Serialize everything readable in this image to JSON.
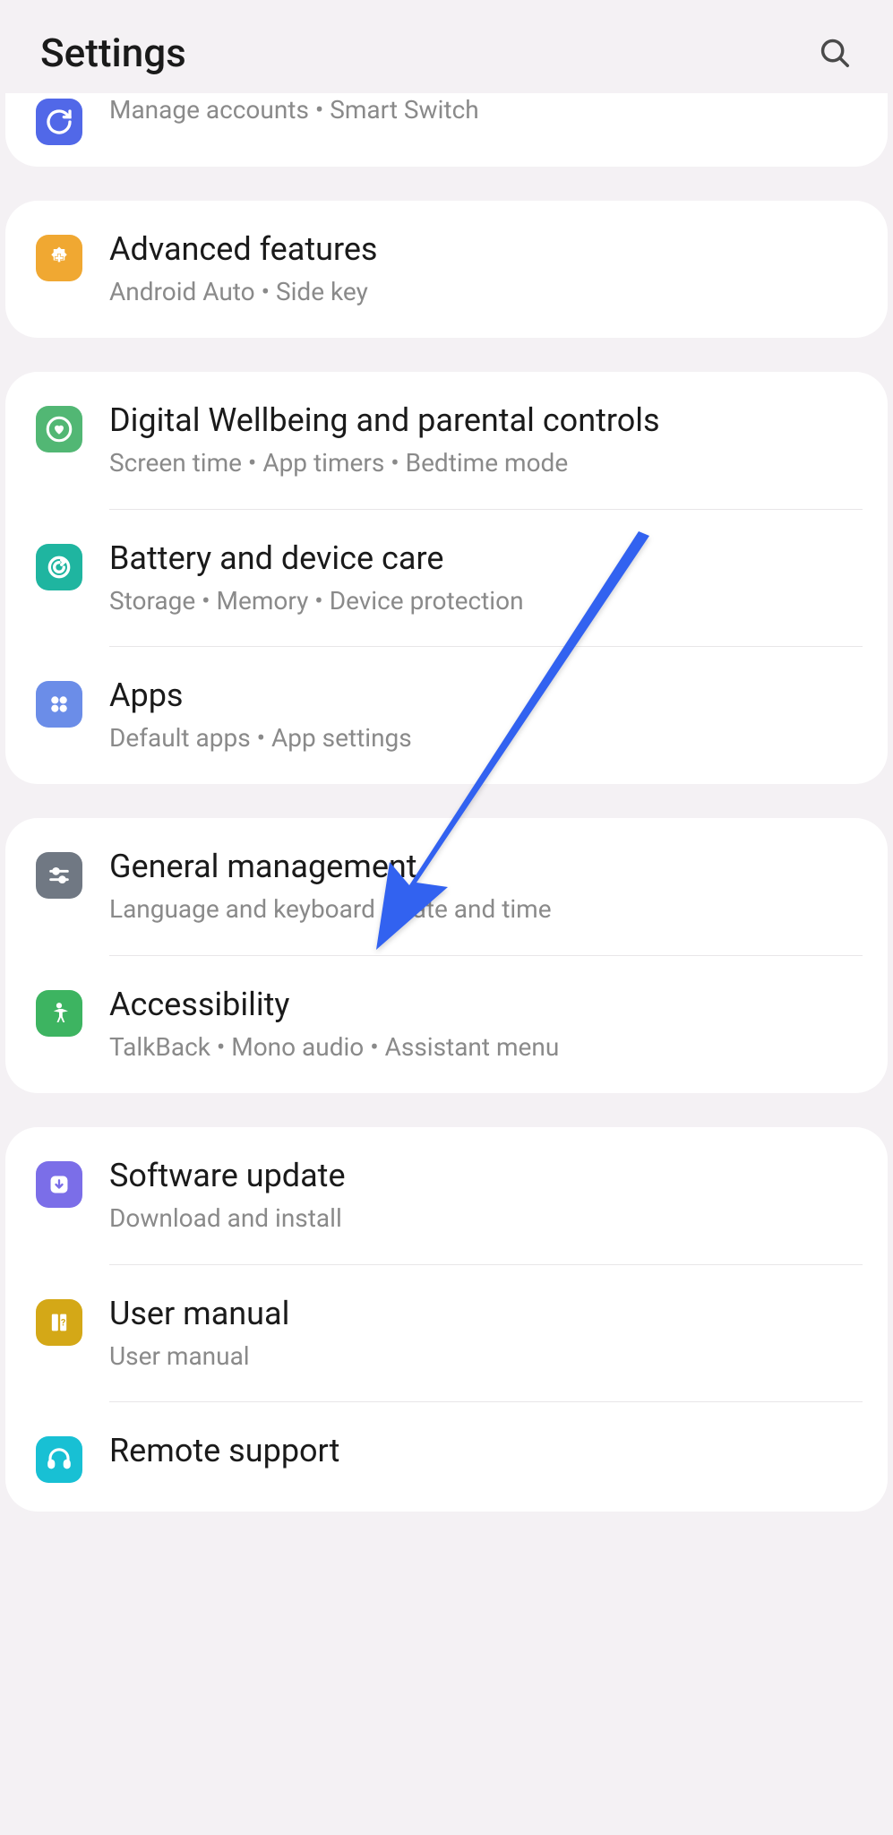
{
  "header": {
    "title": "Settings"
  },
  "groups": [
    {
      "items": [
        {
          "id": "accounts-backup",
          "title": "",
          "subtitle": "Manage accounts  •  Smart Switch",
          "icon": "sync-icon",
          "iconBg": "bg-blue",
          "partial": true
        }
      ],
      "partialTop": true
    },
    {
      "items": [
        {
          "id": "advanced-features",
          "title": "Advanced features",
          "subtitle": "Android Auto  •  Side key",
          "icon": "plus-gear-icon",
          "iconBg": "bg-orange"
        }
      ]
    },
    {
      "items": [
        {
          "id": "digital-wellbeing",
          "title": "Digital Wellbeing and parental controls",
          "subtitle": "Screen time  •  App timers  •  Bedtime mode",
          "icon": "heart-circle-icon",
          "iconBg": "bg-green"
        },
        {
          "id": "battery-device-care",
          "title": "Battery and device care",
          "subtitle": "Storage  •  Memory  •  Device protection",
          "icon": "refresh-icon",
          "iconBg": "bg-teal"
        },
        {
          "id": "apps",
          "title": "Apps",
          "subtitle": "Default apps  •  App settings",
          "icon": "four-dots-icon",
          "iconBg": "bg-lightblue"
        }
      ]
    },
    {
      "items": [
        {
          "id": "general-management",
          "title": "General management",
          "subtitle": "Language and keyboard  •  Date and time",
          "icon": "sliders-icon",
          "iconBg": "bg-gray"
        },
        {
          "id": "accessibility",
          "title": "Accessibility",
          "subtitle": "TalkBack  •  Mono audio  •  Assistant menu",
          "icon": "person-icon",
          "iconBg": "bg-green2"
        }
      ]
    },
    {
      "items": [
        {
          "id": "software-update",
          "title": "Software update",
          "subtitle": "Download and install",
          "icon": "download-icon",
          "iconBg": "bg-purple"
        },
        {
          "id": "user-manual",
          "title": "User manual",
          "subtitle": "User manual",
          "icon": "book-icon",
          "iconBg": "bg-yellow"
        },
        {
          "id": "remote-support",
          "title": "Remote support",
          "subtitle": "",
          "icon": "headset-icon",
          "iconBg": "bg-cyan"
        }
      ]
    }
  ]
}
